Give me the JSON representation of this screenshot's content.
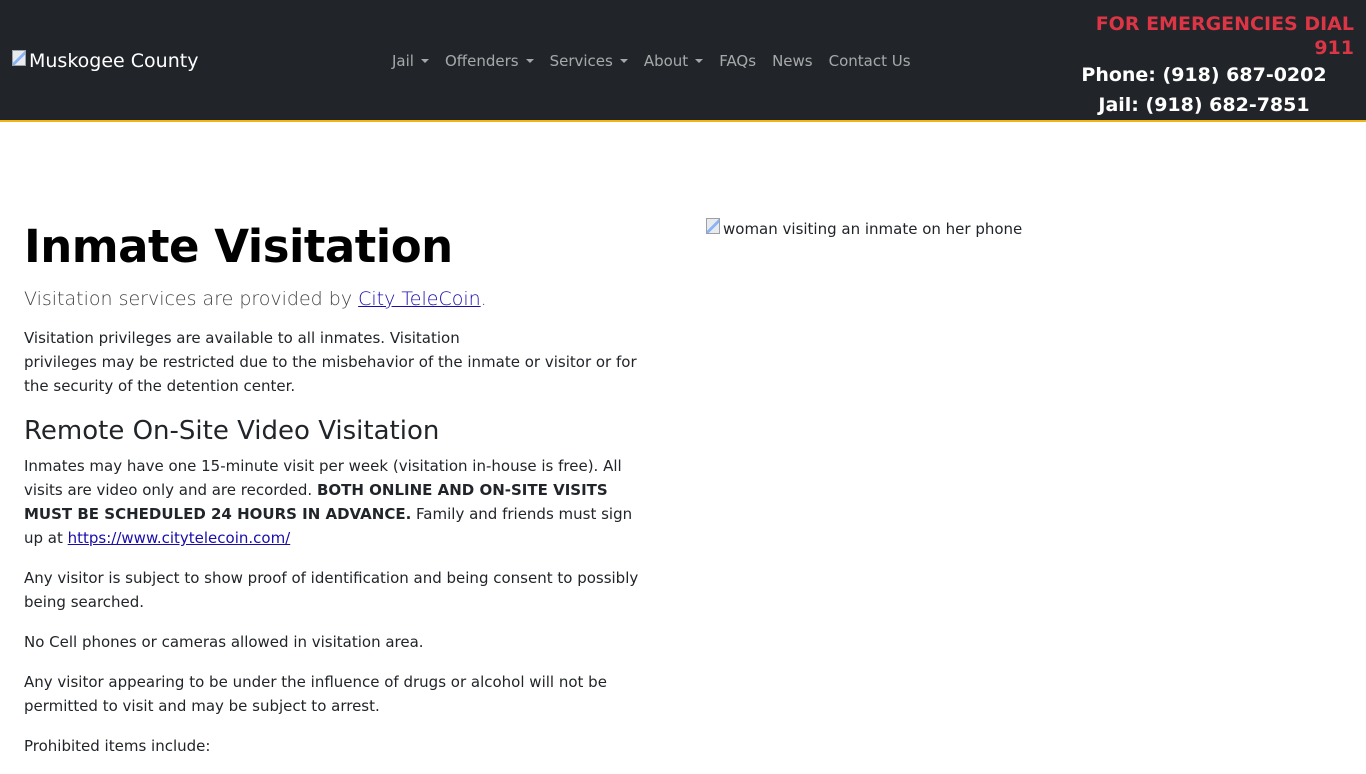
{
  "header": {
    "brand_alt": "Muskogee County",
    "nav": [
      {
        "label": "Jail",
        "dropdown": true
      },
      {
        "label": "Offenders",
        "dropdown": true
      },
      {
        "label": "Services",
        "dropdown": true
      },
      {
        "label": "About",
        "dropdown": true
      },
      {
        "label": "FAQs",
        "dropdown": false
      },
      {
        "label": "News",
        "dropdown": false
      },
      {
        "label": "Contact Us",
        "dropdown": false
      }
    ],
    "emergency": "FOR EMERGENCIES DIAL 911",
    "phone": "Phone: (918) 687-0202",
    "jail_phone": "Jail: (918) 682-7851"
  },
  "colors": {
    "navbar_bg": "#212529",
    "accent_border": "#f0b418",
    "emergency_red": "#dc3545"
  },
  "main": {
    "title": "Inmate Visitation",
    "lead_prefix": "Visitation services are provided by ",
    "lead_link": "City TeleCoin",
    "lead_suffix": ".",
    "para1_line1": "Visitation privileges are available to all inmates. Visitation",
    "para1_rest": "privileges may be restricted due to the misbehavior of the inmate or visitor or for the security of the detention center.",
    "section_title": "Remote On-Site Video Visitation",
    "para2_start": "Inmates may have one 15-minute visit per week (visitation in-house is free). All visits are video only and are recorded. ",
    "para2_bold": "BOTH ONLINE AND ON-SITE VISITS MUST BE SCHEDULED 24 HOURS IN ADVANCE.",
    "para2_end": " Family and friends must sign up at ",
    "para2_link": "https://www.citytelecoin.com/",
    "para3": "Any visitor is subject to show proof of identification and being consent to possibly being searched.",
    "para4": "No Cell phones or cameras allowed in visitation area.",
    "para5": "Any visitor appearing to be under the influence of drugs or alcohol will not be permitted to visit and may be subject to arrest.",
    "para6": "Prohibited items include:"
  },
  "image": {
    "alt": "woman visiting an inmate on her phone"
  }
}
